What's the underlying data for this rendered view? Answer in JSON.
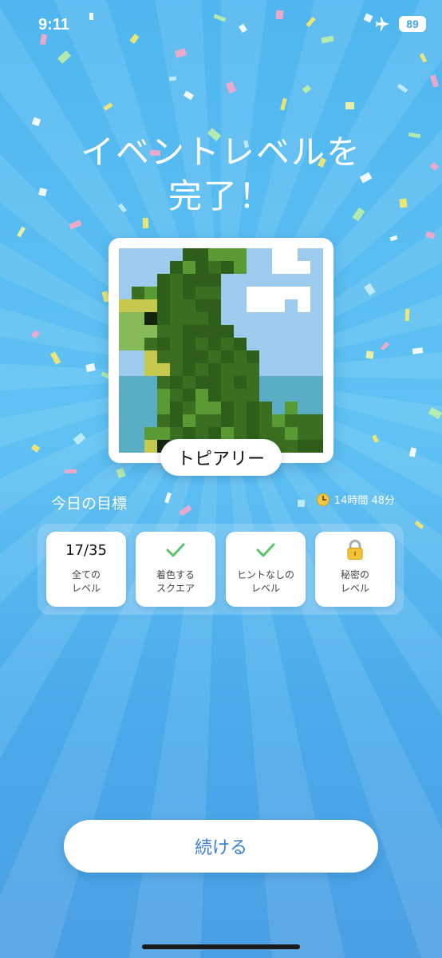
{
  "status": {
    "time": "9:11",
    "battery": "89"
  },
  "headline": {
    "line1": "イベントレベルを",
    "line2": "完了！"
  },
  "picture": {
    "name": "トピアリー"
  },
  "goals": {
    "title": "今日の目標",
    "timer": "14時間 48分",
    "items": [
      {
        "value": "17/35",
        "label": "全ての\nレベル",
        "icon": ""
      },
      {
        "value": "",
        "label": "着色する\nスクエア",
        "icon": "check-icon"
      },
      {
        "value": "",
        "label": "ヒントなしの\nレベル",
        "icon": "check-icon"
      },
      {
        "value": "",
        "label": "秘密の\nレベル",
        "icon": "lock-icon"
      }
    ]
  },
  "continue_label": "続ける",
  "colors": {
    "check": "#5cc46a",
    "accent": "#3a7fd0",
    "art_palette": [
      "#9ccbee",
      "#ffffff",
      "#5aaec4",
      "#2f5e1a",
      "#3b6e21",
      "#5a9a34",
      "#86b957",
      "#c7c94e",
      "#14240c"
    ]
  }
}
